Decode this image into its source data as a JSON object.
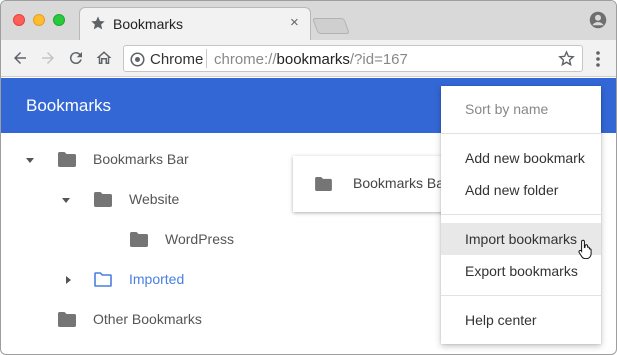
{
  "browser": {
    "tab_title": "Bookmarks",
    "tab_close": "×",
    "site_label": "Chrome",
    "url_scheme": "chrome://",
    "url_host": "bookmarks",
    "url_rest": "/?id=167"
  },
  "header": {
    "title": "Bookmarks"
  },
  "tree": {
    "bookmarks_bar": "Bookmarks Bar",
    "website": "Website",
    "wordpress": "WordPress",
    "imported": "Imported",
    "other_bookmarks": "Other Bookmarks"
  },
  "list": {
    "item_label": "Bookmarks Bar"
  },
  "menu": {
    "sort_by_name": "Sort by name",
    "add_new_bookmark": "Add new bookmark",
    "add_new_folder": "Add new folder",
    "import_bookmarks": "Import bookmarks",
    "export_bookmarks": "Export bookmarks",
    "help_center": "Help center"
  },
  "colors": {
    "header": "#3367d6",
    "selected_folder": "#4a7fe0",
    "folder": "#757575"
  }
}
